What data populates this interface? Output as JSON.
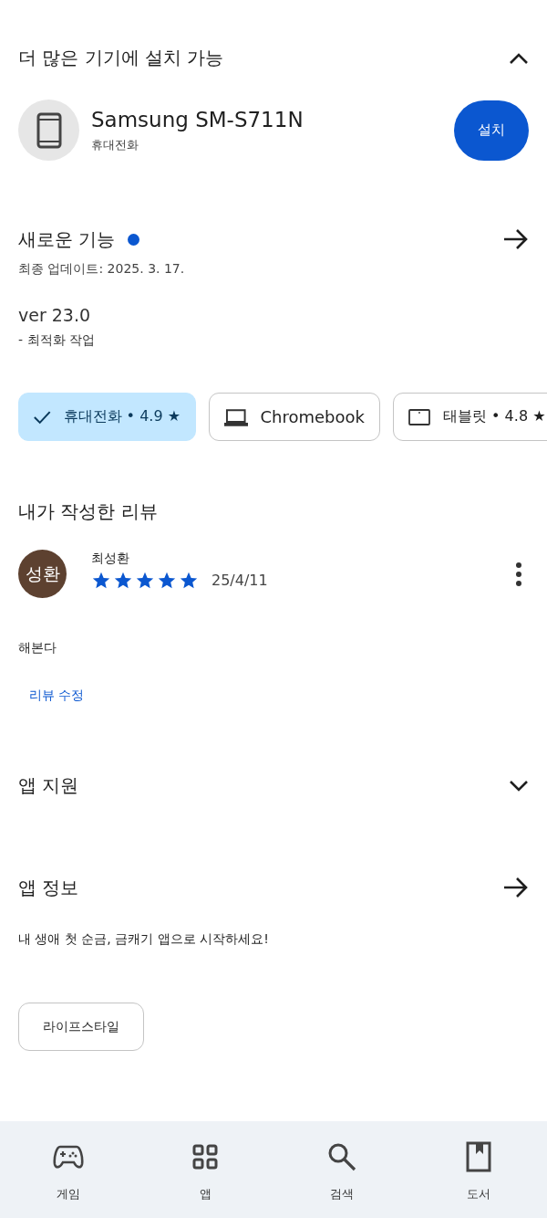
{
  "install_section": {
    "title": "더 많은 기기에 설치 가능",
    "expanded": true,
    "device": {
      "name": "Samsung SM-S711N",
      "type": "휴대전화",
      "button": "설치"
    }
  },
  "whats_new": {
    "title": "새로운 기능",
    "unread": true,
    "updated": "최종 업데이트: 2025. 3. 17.",
    "version": "ver 23.0",
    "notes": "- 최적화 작업"
  },
  "device_chips": [
    {
      "kind": "phone",
      "label": "휴대전화 • 4.9 ★",
      "selected": true
    },
    {
      "kind": "laptop",
      "label": "Chromebook",
      "selected": false
    },
    {
      "kind": "tablet",
      "label": "태블릿 • 4.8 ★",
      "selected": false
    }
  ],
  "my_review": {
    "title": "내가 작성한 리뷰",
    "author": "최성환",
    "avatar_text": "성환",
    "stars": 5,
    "date": "25/4/11",
    "text": "해본다",
    "edit_link": "리뷰 수정"
  },
  "app_support": {
    "title": "앱 지원",
    "expanded": false
  },
  "app_info": {
    "title": "앱 정보",
    "description": "내 생애 첫 순금, 금캐기 앱으로 시작하세요!",
    "tags": [
      "라이프스타일"
    ]
  },
  "bottom_nav": [
    {
      "kind": "games",
      "label": "게임"
    },
    {
      "kind": "apps",
      "label": "앱"
    },
    {
      "kind": "search",
      "label": "검색"
    },
    {
      "kind": "books",
      "label": "도서"
    }
  ]
}
